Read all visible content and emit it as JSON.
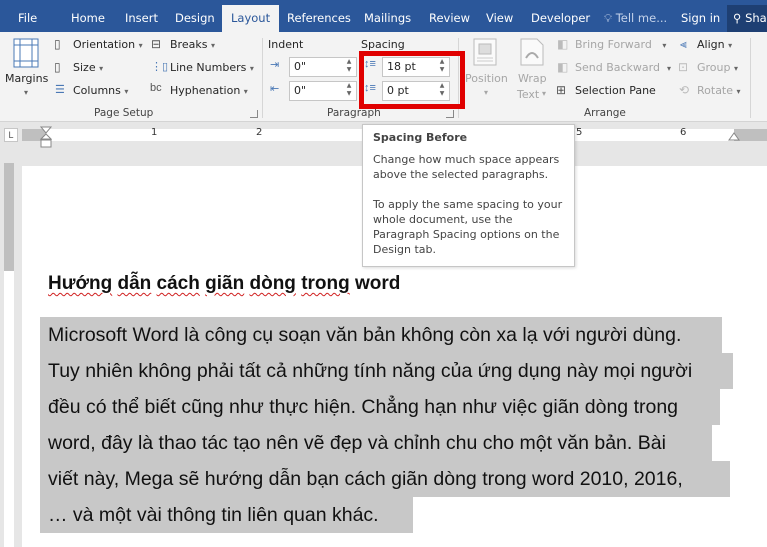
{
  "tabs": {
    "file": "File",
    "home": "Home",
    "insert": "Insert",
    "design": "Design",
    "layout": "Layout",
    "references": "References",
    "mailings": "Mailings",
    "review": "Review",
    "view": "View",
    "developer": "Developer",
    "tell_me": "Tell me...",
    "sign_in": "Sign in",
    "share": "Share"
  },
  "page_setup": {
    "group_label": "Page Setup",
    "margins": "Margins",
    "orientation": "Orientation",
    "size": "Size",
    "columns": "Columns",
    "breaks": "Breaks",
    "line_numbers": "Line Numbers",
    "hyphenation": "Hyphenation"
  },
  "paragraph": {
    "group_label": "Paragraph",
    "indent_label": "Indent",
    "spacing_label": "Spacing",
    "indent_left": "0\"",
    "indent_right": "0\"",
    "spacing_before": "18 pt",
    "spacing_after": "0 pt"
  },
  "arrange": {
    "group_label": "Arrange",
    "position": "Position",
    "wrap_text_1": "Wrap",
    "wrap_text_2": "Text",
    "bring_forward": "Bring Forward",
    "send_backward": "Send Backward",
    "selection_pane": "Selection Pane",
    "align": "Align",
    "group": "Group",
    "rotate": "Rotate"
  },
  "ruler": {
    "corner": "L",
    "numbers": [
      "1",
      "2",
      "5",
      "6"
    ]
  },
  "tooltip": {
    "title": "Spacing Before",
    "line1": "Change how much space appears",
    "line2": "above the selected paragraphs.",
    "line3": "To apply the same spacing to your",
    "line4": "whole document, use the",
    "line5": "Paragraph Spacing options on the",
    "line6": "Design tab."
  },
  "document": {
    "heading_words": [
      "Hướng",
      "dẫn",
      "cách",
      "giãn",
      "dòng",
      "trong",
      "word"
    ],
    "lines": [
      "Microsoft Word là công cụ soạn văn bản không còn xa lạ với người dùng.",
      "Tuy nhiên không phải tất cả những tính năng của ứng dụng này mọi người",
      "đều có thể biết cũng như thực hiện. Chẳng hạn như việc giãn dòng trong",
      "word, đây là thao tác tạo nên vẽ đẹp và chỉnh chu cho một văn bản. Bài",
      "viết này, Mega sẽ hướng dẫn bạn cách giãn dòng trong word 2010, 2016,",
      "… và một vài thông tin liên quan khác."
    ]
  },
  "colors": {
    "title_bar": "#2b579a",
    "highlight_box": "#e00000",
    "selection": "#c8c8c8"
  }
}
